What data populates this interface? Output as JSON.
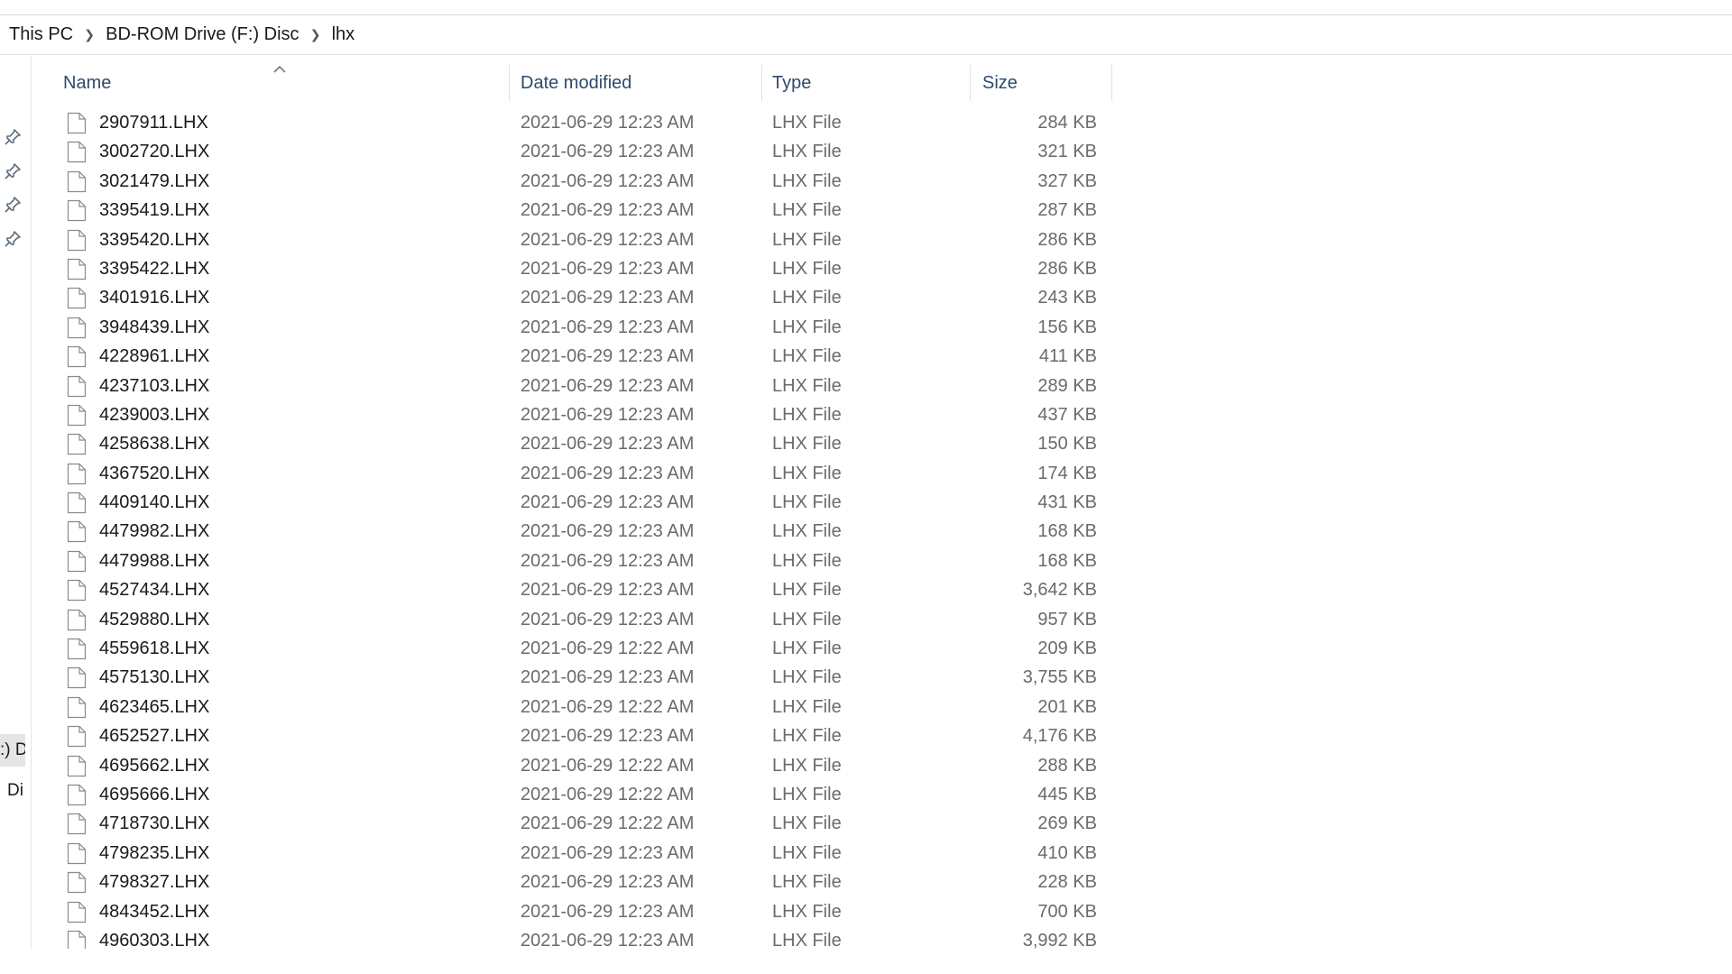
{
  "breadcrumb": [
    "This PC",
    "BD-ROM Drive (F:) Disc",
    "lhx"
  ],
  "nav_fragments": [
    ":) D",
    "Di"
  ],
  "columns": {
    "name": "Name",
    "date": "Date modified",
    "type": "Type",
    "size": "Size"
  },
  "icons": {
    "pin": "pin-icon",
    "file": "file-icon",
    "sort": "sort-ascending-icon",
    "chevron": "chevron-right-icon"
  },
  "colors": {
    "header_text": "#2f4a6b",
    "secondary_text": "#6b6b6b",
    "selection": "#e5e5e5"
  },
  "files": [
    {
      "name": "2907911.LHX",
      "date": "2021-06-29 12:23 AM",
      "type": "LHX File",
      "size": "284 KB"
    },
    {
      "name": "3002720.LHX",
      "date": "2021-06-29 12:23 AM",
      "type": "LHX File",
      "size": "321 KB"
    },
    {
      "name": "3021479.LHX",
      "date": "2021-06-29 12:23 AM",
      "type": "LHX File",
      "size": "327 KB"
    },
    {
      "name": "3395419.LHX",
      "date": "2021-06-29 12:23 AM",
      "type": "LHX File",
      "size": "287 KB"
    },
    {
      "name": "3395420.LHX",
      "date": "2021-06-29 12:23 AM",
      "type": "LHX File",
      "size": "286 KB"
    },
    {
      "name": "3395422.LHX",
      "date": "2021-06-29 12:23 AM",
      "type": "LHX File",
      "size": "286 KB"
    },
    {
      "name": "3401916.LHX",
      "date": "2021-06-29 12:23 AM",
      "type": "LHX File",
      "size": "243 KB"
    },
    {
      "name": "3948439.LHX",
      "date": "2021-06-29 12:23 AM",
      "type": "LHX File",
      "size": "156 KB"
    },
    {
      "name": "4228961.LHX",
      "date": "2021-06-29 12:23 AM",
      "type": "LHX File",
      "size": "411 KB"
    },
    {
      "name": "4237103.LHX",
      "date": "2021-06-29 12:23 AM",
      "type": "LHX File",
      "size": "289 KB"
    },
    {
      "name": "4239003.LHX",
      "date": "2021-06-29 12:23 AM",
      "type": "LHX File",
      "size": "437 KB"
    },
    {
      "name": "4258638.LHX",
      "date": "2021-06-29 12:23 AM",
      "type": "LHX File",
      "size": "150 KB"
    },
    {
      "name": "4367520.LHX",
      "date": "2021-06-29 12:23 AM",
      "type": "LHX File",
      "size": "174 KB"
    },
    {
      "name": "4409140.LHX",
      "date": "2021-06-29 12:23 AM",
      "type": "LHX File",
      "size": "431 KB"
    },
    {
      "name": "4479982.LHX",
      "date": "2021-06-29 12:23 AM",
      "type": "LHX File",
      "size": "168 KB"
    },
    {
      "name": "4479988.LHX",
      "date": "2021-06-29 12:23 AM",
      "type": "LHX File",
      "size": "168 KB"
    },
    {
      "name": "4527434.LHX",
      "date": "2021-06-29 12:23 AM",
      "type": "LHX File",
      "size": "3,642 KB"
    },
    {
      "name": "4529880.LHX",
      "date": "2021-06-29 12:23 AM",
      "type": "LHX File",
      "size": "957 KB"
    },
    {
      "name": "4559618.LHX",
      "date": "2021-06-29 12:22 AM",
      "type": "LHX File",
      "size": "209 KB"
    },
    {
      "name": "4575130.LHX",
      "date": "2021-06-29 12:23 AM",
      "type": "LHX File",
      "size": "3,755 KB"
    },
    {
      "name": "4623465.LHX",
      "date": "2021-06-29 12:22 AM",
      "type": "LHX File",
      "size": "201 KB"
    },
    {
      "name": "4652527.LHX",
      "date": "2021-06-29 12:23 AM",
      "type": "LHX File",
      "size": "4,176 KB"
    },
    {
      "name": "4695662.LHX",
      "date": "2021-06-29 12:22 AM",
      "type": "LHX File",
      "size": "288 KB"
    },
    {
      "name": "4695666.LHX",
      "date": "2021-06-29 12:22 AM",
      "type": "LHX File",
      "size": "445 KB"
    },
    {
      "name": "4718730.LHX",
      "date": "2021-06-29 12:22 AM",
      "type": "LHX File",
      "size": "269 KB"
    },
    {
      "name": "4798235.LHX",
      "date": "2021-06-29 12:23 AM",
      "type": "LHX File",
      "size": "410 KB"
    },
    {
      "name": "4798327.LHX",
      "date": "2021-06-29 12:23 AM",
      "type": "LHX File",
      "size": "228 KB"
    },
    {
      "name": "4843452.LHX",
      "date": "2021-06-29 12:23 AM",
      "type": "LHX File",
      "size": "700 KB"
    },
    {
      "name": "4960303.LHX",
      "date": "2021-06-29 12:23 AM",
      "type": "LHX File",
      "size": "3,992 KB"
    }
  ]
}
